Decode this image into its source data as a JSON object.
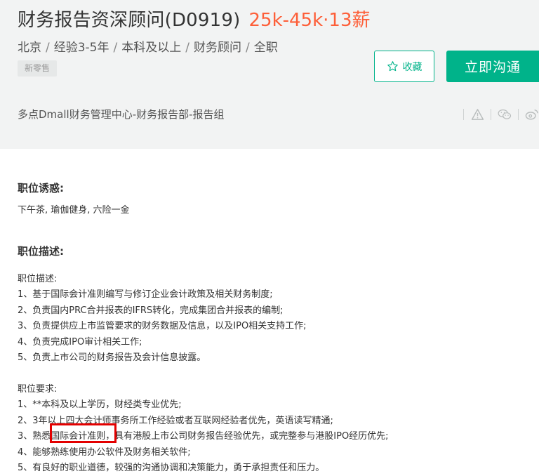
{
  "job": {
    "title": "财务报告资深顾问(D0919)",
    "salary": "25k-45k·13薪"
  },
  "meta": {
    "location": "北京",
    "experience": "经验3-5年",
    "education": "本科及以上",
    "category": "财务顾问",
    "type": "全职",
    "separator": "/"
  },
  "tag": "新零售",
  "buttons": {
    "favorite": "收藏",
    "chat": "立即沟通"
  },
  "department": "多点Dmall财务管理中心-财务报告部-报告组",
  "icons": [
    "warning-icon",
    "wechat-icon",
    "weibo-icon"
  ],
  "sections": {
    "benefits_title": "职位诱惑:",
    "benefits_text": "下午茶, 瑜伽健身, 六险一金",
    "description_title": "职位描述:",
    "desc_heading": "职位描述:",
    "desc_items": [
      "1、基于国际会计准则编写与修订企业会计政策及相关财务制度;",
      "2、负责国内PRC合并报表的IFRS转化，完成集团合并报表的编制;",
      "3、负责提供应上市监管要求的财务数据及信息，以及IPO相关支持工作;",
      "4、负责完成IPO审计相关工作;",
      "5、负责上市公司的财务报告及会计信息披露。"
    ],
    "req_heading": "职位要求:",
    "req_items": [
      "1、**本科及以上学历，财经类专业优先;",
      "2、3年以上四大会计师事务所工作经验或者互联网经验者优先，英语读写精通;",
      "3、熟悉国际会计准则，具有港股上市公司财务报告经验优先，或完整参与港股IPO经历优先;",
      "4、能够熟练使用办公软件及财务相关软件;",
      "5、有良好的职业道德，较强的沟通协调和决策能力，勇于承担责任和压力。"
    ]
  },
  "colors": {
    "accent": "#00b38a",
    "salary": "#fd5f39",
    "highlight": "#e30000",
    "header_bg": "#f2f3f3"
  }
}
